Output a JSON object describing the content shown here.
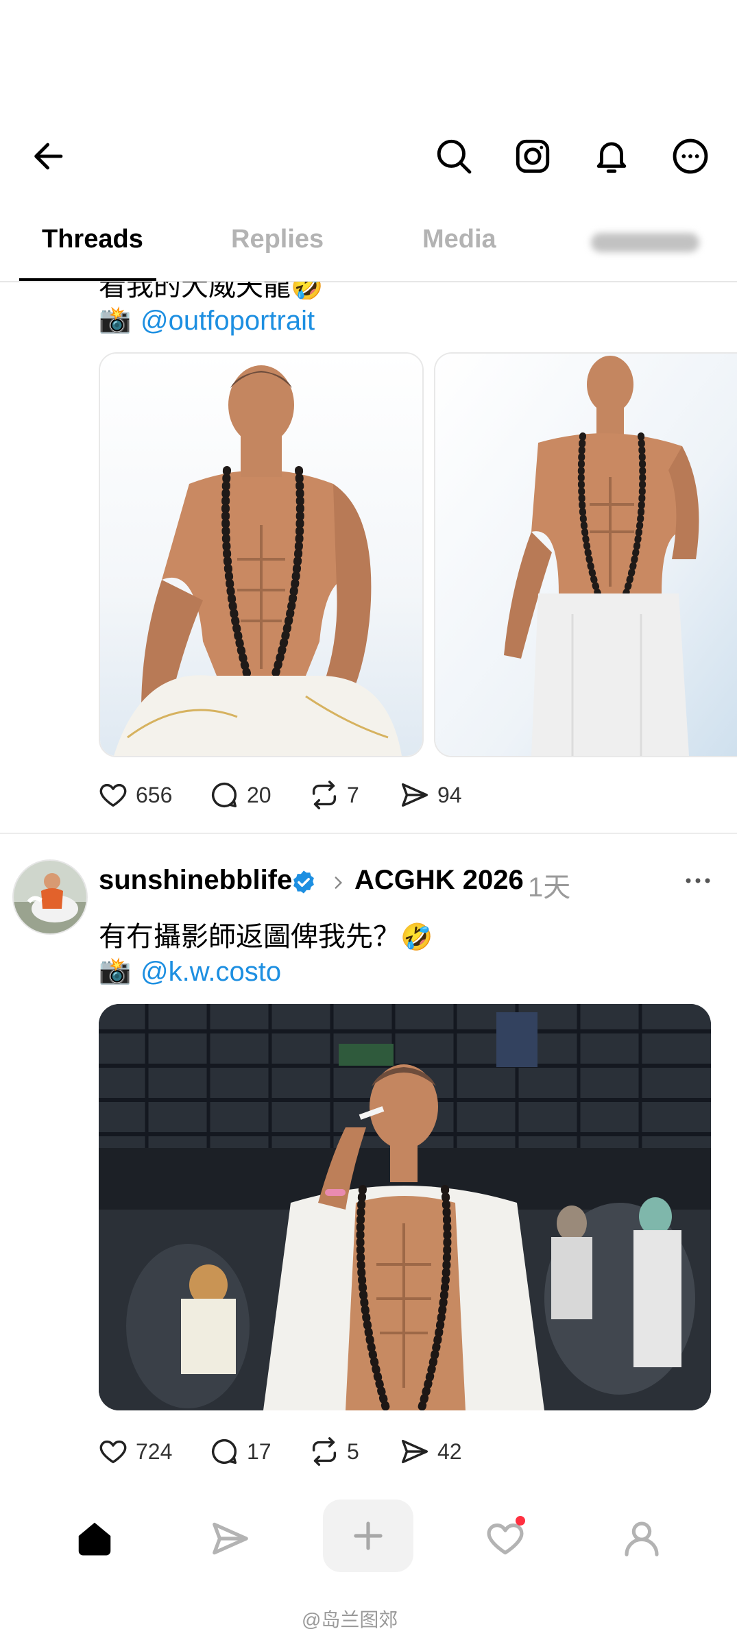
{
  "header": {
    "back_icon": "arrow-left-icon",
    "actions": [
      "search-icon",
      "instagram-icon",
      "bell-icon",
      "more-icon"
    ]
  },
  "tabs": [
    {
      "label": "Threads",
      "active": true
    },
    {
      "label": "Replies",
      "active": false
    },
    {
      "label": "Media",
      "active": false
    },
    {
      "label": "",
      "blurred": true
    }
  ],
  "post1": {
    "caption_cut": "看我的大威天龍",
    "caption_emoji": "🤣",
    "camera_emoji": "📸",
    "mention": "@outfoportrait",
    "stats": {
      "likes": "656",
      "comments": "20",
      "reposts": "7",
      "shares": "94"
    }
  },
  "post2": {
    "username": "sunshinebblife",
    "verified": true,
    "community": "ACGHK 2026",
    "time": "1天",
    "caption": "有冇攝影師返圖俾我先？",
    "caption_emoji": "🤣",
    "camera_emoji": "📸",
    "mention": "@k.w.costo",
    "stats": {
      "likes": "724",
      "comments": "17",
      "reposts": "5",
      "shares": "42"
    }
  },
  "nav": {
    "items": [
      "home-icon",
      "send-icon",
      "plus-icon",
      "heart-icon",
      "profile-icon"
    ],
    "active": "home-icon",
    "has_notification": "heart-icon"
  },
  "watermark": "@岛兰图郊",
  "colors": {
    "link": "#1d8fe1",
    "verified": "#1d8fe1",
    "notification": "#ff3040"
  }
}
